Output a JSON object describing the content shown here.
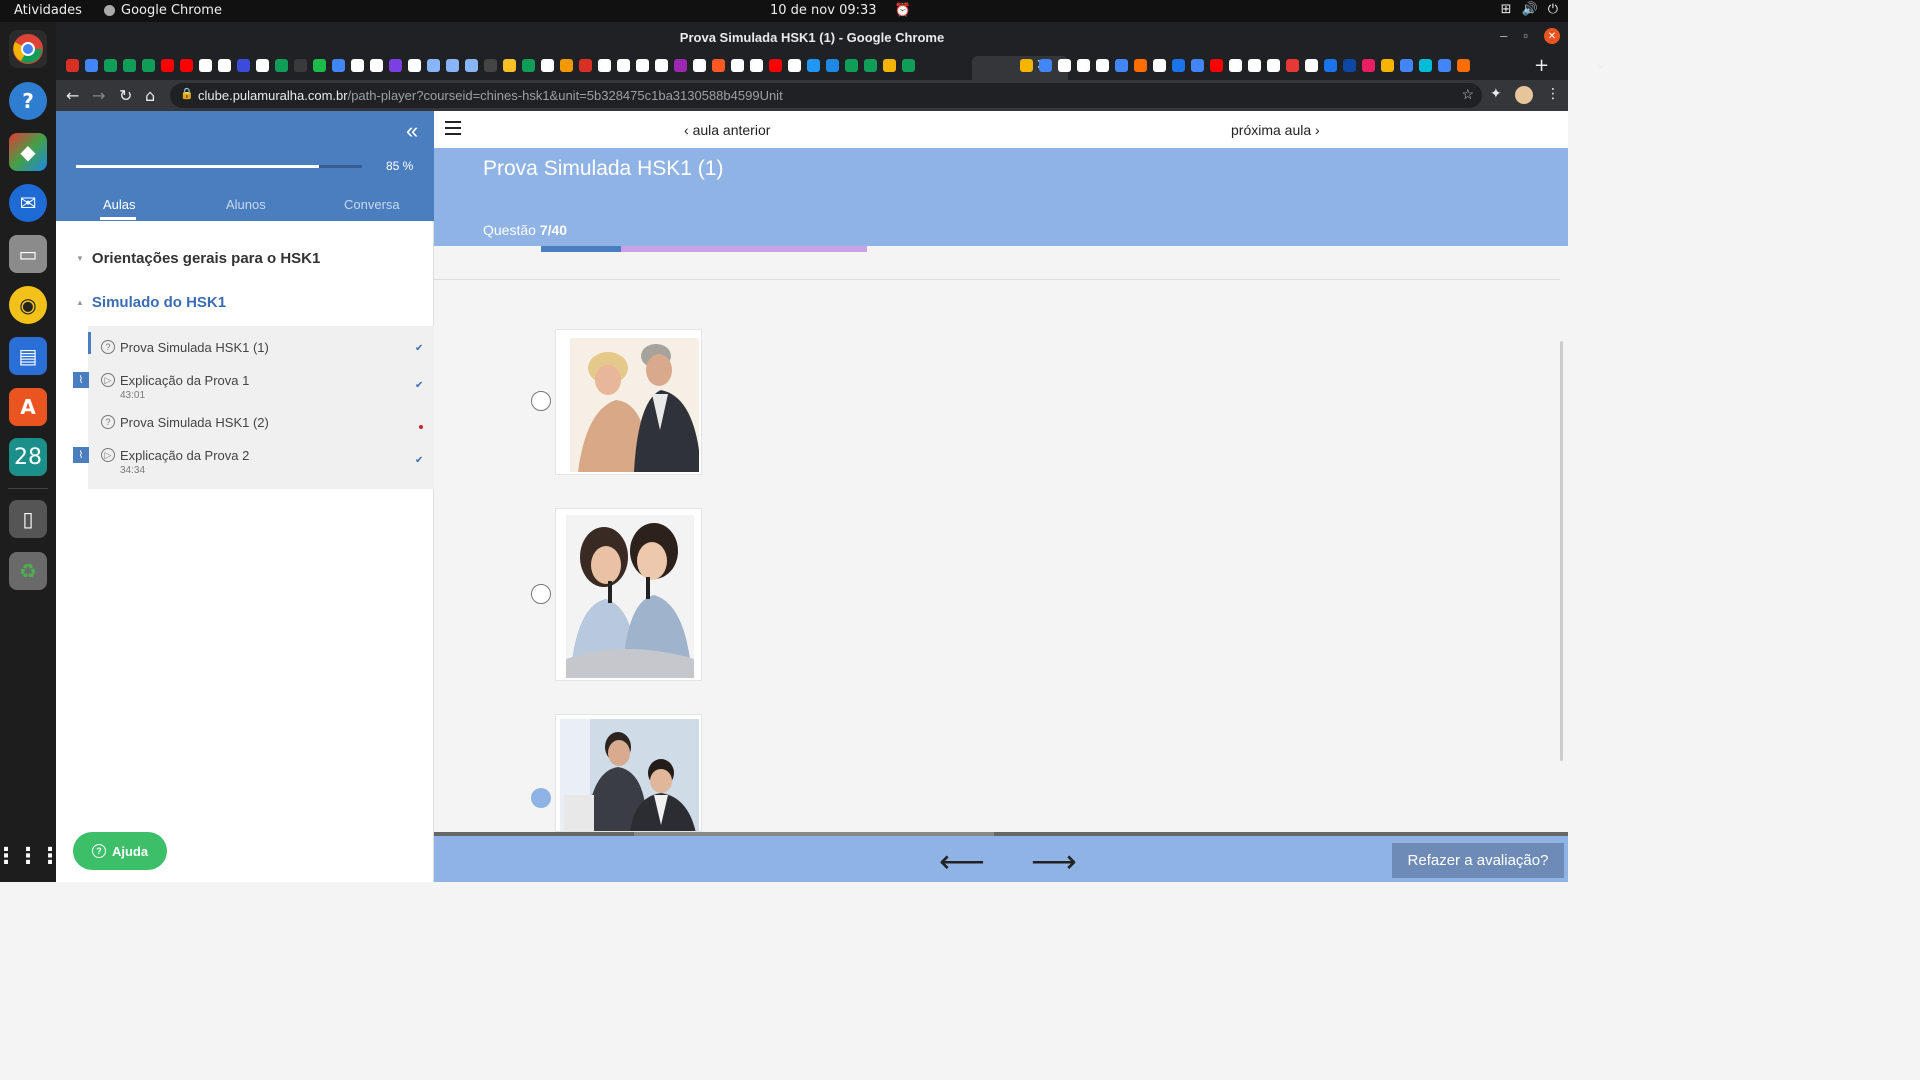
{
  "system": {
    "activities": "Atividades",
    "app_name": "Google Chrome",
    "clock": "10 de nov  09:33"
  },
  "dock": {
    "calendar_day": "28"
  },
  "browser": {
    "window_title": "Prova Simulada HSK1 (1) - Google Chrome",
    "url_host": "clube.pulamuralha.com.br",
    "url_path": "/path-player?courseid=chines-hsk1&unit=5b328475c1ba3130588b4599Unit",
    "favicon_colors": [
      "#d93025",
      "#4285f4",
      "#0f9d58",
      "#0f9d58",
      "#0f9d58",
      "#ff0000",
      "#ff0000",
      "#ffffff",
      "#ffffff",
      "#3c4bdc",
      "#ffffff",
      "#0f9d58",
      "#3a3a3a",
      "#1bbc4a",
      "#4285f4",
      "#ffffff",
      "#ffffff",
      "#7b3fe4",
      "#ffffff",
      "#8ab4f8",
      "#8ab4f8",
      "#8ab4f8",
      "#444444",
      "#f6c026",
      "#0f9d58",
      "#ffffff",
      "#f29900",
      "#d93025",
      "#ffffff",
      "#ffffff",
      "#ffffff",
      "#ffffff",
      "#9c27b0",
      "#ffffff",
      "#ff5722",
      "#ffffff",
      "#ffffff",
      "#ff0000",
      "#ffffff",
      "#2196f3",
      "#1e88e5",
      "#0f9d58",
      "#0f9d58",
      "#f4b400",
      "#0f9d58"
    ],
    "favicon_colors_right": [
      "#f4b400",
      "#4285f4",
      "#ffffff",
      "#ffffff",
      "#ffffff",
      "#4285f4",
      "#ff6d00",
      "#ffffff",
      "#1a73e8",
      "#4285f4",
      "#ff0000",
      "#ffffff",
      "#ffffff",
      "#ffffff",
      "#e53935",
      "#ffffff",
      "#1a73e8",
      "#0d47a1",
      "#e91e63",
      "#f4b400",
      "#4285f4",
      "#00bcd4",
      "#4285f4",
      "#ff6d00"
    ]
  },
  "sidebar": {
    "progress_percent": 85,
    "progress_label": "85 %",
    "tabs": [
      {
        "label": "Aulas",
        "active": true
      },
      {
        "label": "Alunos",
        "active": false
      },
      {
        "label": "Conversa",
        "active": false
      }
    ],
    "sections": [
      {
        "title": "Orientações gerais para o HSK1",
        "color": "#333333"
      },
      {
        "title": "Simulado do HSK1",
        "color": "#3b6db4"
      }
    ],
    "lessons": [
      {
        "title": "Prova Simulada HSK1 (1)",
        "duration": "",
        "status": "done"
      },
      {
        "title": "Explicação da Prova 1",
        "duration": "43:01",
        "status": "done"
      },
      {
        "title": "Prova Simulada HSK1 (2)",
        "duration": "",
        "status": "pending"
      },
      {
        "title": "Explicação da Prova 2",
        "duration": "34:34",
        "status": "done"
      }
    ],
    "help_label": "Ajuda"
  },
  "main": {
    "prev_label": "aula anterior",
    "next_label": "próxima aula",
    "title": "Prova Simulada HSK1 (1)",
    "question_label": "Questão",
    "question_number": "7/40",
    "audio_progress": 0.245,
    "options": [
      {
        "image": "man-and-woman-dancing-photo",
        "selected": false
      },
      {
        "image": "two-women-singing-karaoke-photo",
        "selected": false
      },
      {
        "image": "two-men-at-computer-photo",
        "selected": true
      }
    ],
    "redo_label": "Refazer a avaliação?"
  },
  "colors": {
    "sidebar_header": "#4a7ebf",
    "question_header": "#8fb3e4",
    "help_button": "#3dbf6a",
    "redo_button": "#6d8bb6"
  }
}
